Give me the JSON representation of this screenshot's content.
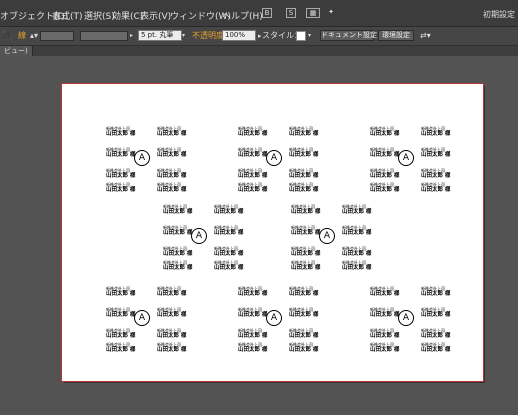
{
  "menubar": {
    "items": [
      "オブジェクト(O)",
      "書式(T)",
      "選択(S)",
      "効果(C)",
      "表示(V)",
      "ウィンドウ(W)",
      "ヘルプ(H)"
    ],
    "right_label": "初期設定"
  },
  "controlbar": {
    "brush": "5 pt. 丸筆",
    "opacity_label": "不透明度",
    "opacity_value": "100%",
    "style_label": "スタイル：",
    "doc_settings": "ドキュメント設定",
    "env_settings": "環境設定"
  },
  "tab": {
    "label": "ビュー)"
  },
  "label": {
    "company": "新株会社上司",
    "name": "山田太郎 様",
    "badge": "A"
  },
  "colors": {
    "artboard_border": "#b33333",
    "canvas": "#535353",
    "menubar": "#3c3c3c"
  }
}
